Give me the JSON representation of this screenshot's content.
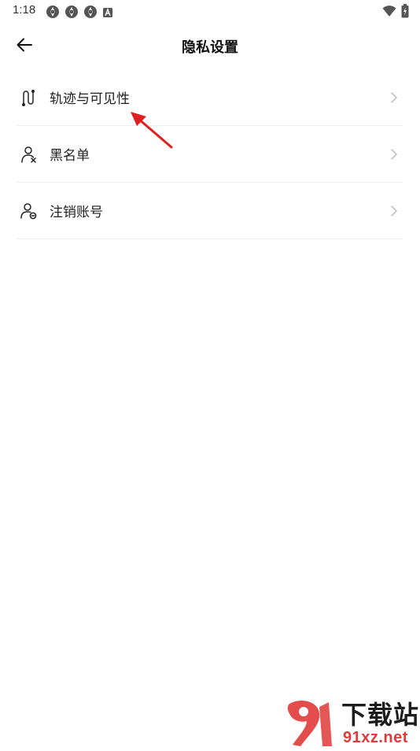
{
  "status_bar": {
    "time": "1:18",
    "left_icons": [
      "app-icon",
      "app-icon",
      "app-icon",
      "keyboard-a-icon"
    ],
    "right_icons": [
      "wifi-icon",
      "battery-charging-icon"
    ]
  },
  "header": {
    "back_icon": "arrow-left-icon",
    "title": "隐私设置"
  },
  "menu": {
    "items": [
      {
        "label": "轨迹与可见性",
        "icon": "route-icon"
      },
      {
        "label": "黑名单",
        "icon": "block-user-icon"
      },
      {
        "label": "注销账号",
        "icon": "user-minus-icon"
      }
    ],
    "chevron_icon": "chevron-right-icon"
  },
  "annotation": {
    "color": "#e02020"
  },
  "watermark": {
    "title": "下载站",
    "url": "91xz.net",
    "accent_color": "#e03a3a"
  }
}
